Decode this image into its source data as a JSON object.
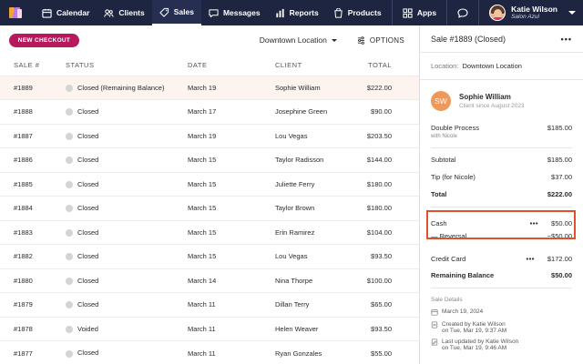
{
  "nav": {
    "items": [
      {
        "label": "Calendar",
        "icon": "calendar-icon"
      },
      {
        "label": "Clients",
        "icon": "clients-icon"
      },
      {
        "label": "Sales",
        "icon": "sales-tag-icon",
        "active": true
      },
      {
        "label": "Messages",
        "icon": "messages-icon"
      },
      {
        "label": "Reports",
        "icon": "reports-icon"
      },
      {
        "label": "Products",
        "icon": "products-icon"
      }
    ],
    "apps_label": "Apps",
    "user_name": "Katie Wilson",
    "user_location": "Salon Azul"
  },
  "toolbar": {
    "new_checkout": "NEW CHECKOUT",
    "location": "Downtown Location",
    "options": "OPTIONS"
  },
  "table": {
    "headers": [
      "SALE #",
      "STATUS",
      "DATE",
      "CLIENT",
      "TOTAL"
    ],
    "rows": [
      {
        "sale": "#1889",
        "status": "Closed (Remaining Balance)",
        "date": "March 19",
        "client": "Sophie William",
        "total": "$222.00"
      },
      {
        "sale": "#1888",
        "status": "Closed",
        "date": "March 17",
        "client": "Josephine Green",
        "total": "$90.00"
      },
      {
        "sale": "#1887",
        "status": "Closed",
        "date": "March 19",
        "client": "Lou Vegas",
        "total": "$203.50"
      },
      {
        "sale": "#1886",
        "status": "Closed",
        "date": "March 15",
        "client": "Taylor Radisson",
        "total": "$144.00"
      },
      {
        "sale": "#1885",
        "status": "Closed",
        "date": "March 15",
        "client": "Juliette Ferry",
        "total": "$180.00"
      },
      {
        "sale": "#1884",
        "status": "Closed",
        "date": "March 15",
        "client": "Taylor Brown",
        "total": "$180.00"
      },
      {
        "sale": "#1883",
        "status": "Closed",
        "date": "March 15",
        "client": "Erin Ramirez",
        "total": "$104.00"
      },
      {
        "sale": "#1882",
        "status": "Closed",
        "date": "March 15",
        "client": "Lou Vegas",
        "total": "$93.50"
      },
      {
        "sale": "#1880",
        "status": "Closed",
        "date": "March 14",
        "client": "Nina Thorpe",
        "total": "$100.00"
      },
      {
        "sale": "#1879",
        "status": "Closed",
        "date": "March 11",
        "client": "Dillan Terry",
        "total": "$65.00"
      },
      {
        "sale": "#1878",
        "status": "Voided",
        "date": "March 11",
        "client": "Helen Weaver",
        "total": "$93.50"
      },
      {
        "sale": "#1877",
        "status": "Closed",
        "date": "March 11",
        "client": "Ryan Gonzales",
        "total": "$55.00"
      }
    ]
  },
  "panel": {
    "title": "Sale #1889 (Closed)",
    "location_label": "Location:",
    "location_value": "Downtown Location",
    "client_initials": "SW",
    "client_name": "Sophie William",
    "client_since": "Client since August 2023",
    "service": "Double Process",
    "service_amount": "$185.00",
    "service_with": "with Nicole",
    "subtotal_label": "Subtotal",
    "subtotal": "$185.00",
    "tip_label": "Tip (for Nicole)",
    "tip": "$37.00",
    "total_label": "Total",
    "total": "$222.00",
    "cash_label": "Cash",
    "cash": "$50.00",
    "reversal_label": "— Reversal",
    "reversal": "−$50.00",
    "card_label": "Credit Card",
    "card": "$172.00",
    "remaining_label": "Remaining Balance",
    "remaining": "$50.00",
    "details_title": "Sale Details",
    "detail_date": "March 19, 2024",
    "created_by": "Created by Katie Wilson",
    "created_on": "on Tue, Mar 19, 9:37 AM",
    "updated_by": "Last updated by Katie Wilson",
    "updated_on": "on Tue, Mar 19, 9:46 AM"
  }
}
